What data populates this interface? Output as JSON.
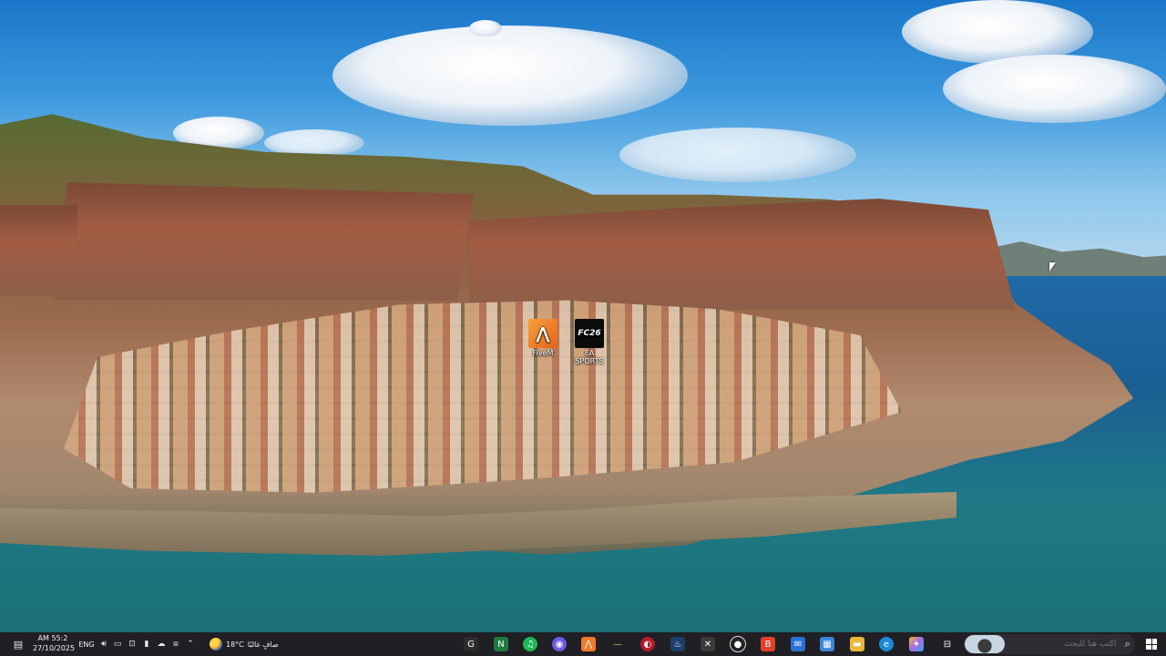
{
  "desktop": {
    "icons": [
      {
        "label": "FiveM",
        "icon": "fivem-logo-icon"
      },
      {
        "label": "EA SPORTS",
        "icon": "fc26-icon",
        "tile_text": "FC26"
      }
    ]
  },
  "taskbar": {
    "notification_icon": "notification-icon",
    "clock": {
      "time": "AM 55:2",
      "date": "27/10/2025"
    },
    "language": "ENG",
    "tray_icons": [
      "volume-icon",
      "network-icon",
      "display-icon",
      "mic-icon",
      "onedrive-icon",
      "camera-icon",
      "chevron-up-icon"
    ],
    "weather": {
      "temp": "18°C",
      "condition": "صافٍ غالبًا",
      "icon": "weather-icon"
    },
    "apps": [
      {
        "name": "app-g",
        "glyph": "G",
        "color": "#2b2b2b"
      },
      {
        "name": "app-excel",
        "glyph": "N",
        "color": "#1f7a3e"
      },
      {
        "name": "app-spotify",
        "glyph": "♫",
        "color": "#1db954"
      },
      {
        "name": "app-pink",
        "glyph": "◉",
        "color": "#6d5ae6"
      },
      {
        "name": "app-fivem",
        "glyph": "⋀",
        "color": "#f07a2b"
      },
      {
        "name": "app-dash",
        "glyph": "—",
        "color": "#3a3a2a"
      },
      {
        "name": "app-red",
        "glyph": "◐",
        "color": "#b31b2b"
      },
      {
        "name": "app-steam",
        "glyph": "♨",
        "color": "#1b3f66"
      },
      {
        "name": "app-box",
        "glyph": "✕",
        "color": "#3a3a3a"
      },
      {
        "name": "app-obs",
        "glyph": "●",
        "color": "#222222"
      },
      {
        "name": "app-brave",
        "glyph": "B",
        "color": "#e2402b"
      },
      {
        "name": "app-mail",
        "glyph": "✉",
        "color": "#2a71d6"
      },
      {
        "name": "app-store",
        "glyph": "▦",
        "color": "#3b87d8"
      },
      {
        "name": "app-files",
        "glyph": "▬",
        "color": "#e8b83a"
      },
      {
        "name": "app-edge",
        "glyph": "e",
        "color": "#1b8ad6"
      },
      {
        "name": "app-copilot",
        "glyph": "✦",
        "color": "#a86ae8"
      },
      {
        "name": "app-taskview",
        "glyph": "⊟",
        "color": "#2b2b2b"
      }
    ],
    "search": {
      "placeholder": "اكتب هنا للبحث",
      "icon": "search-icon"
    },
    "start_icon": "windows-start-icon"
  }
}
